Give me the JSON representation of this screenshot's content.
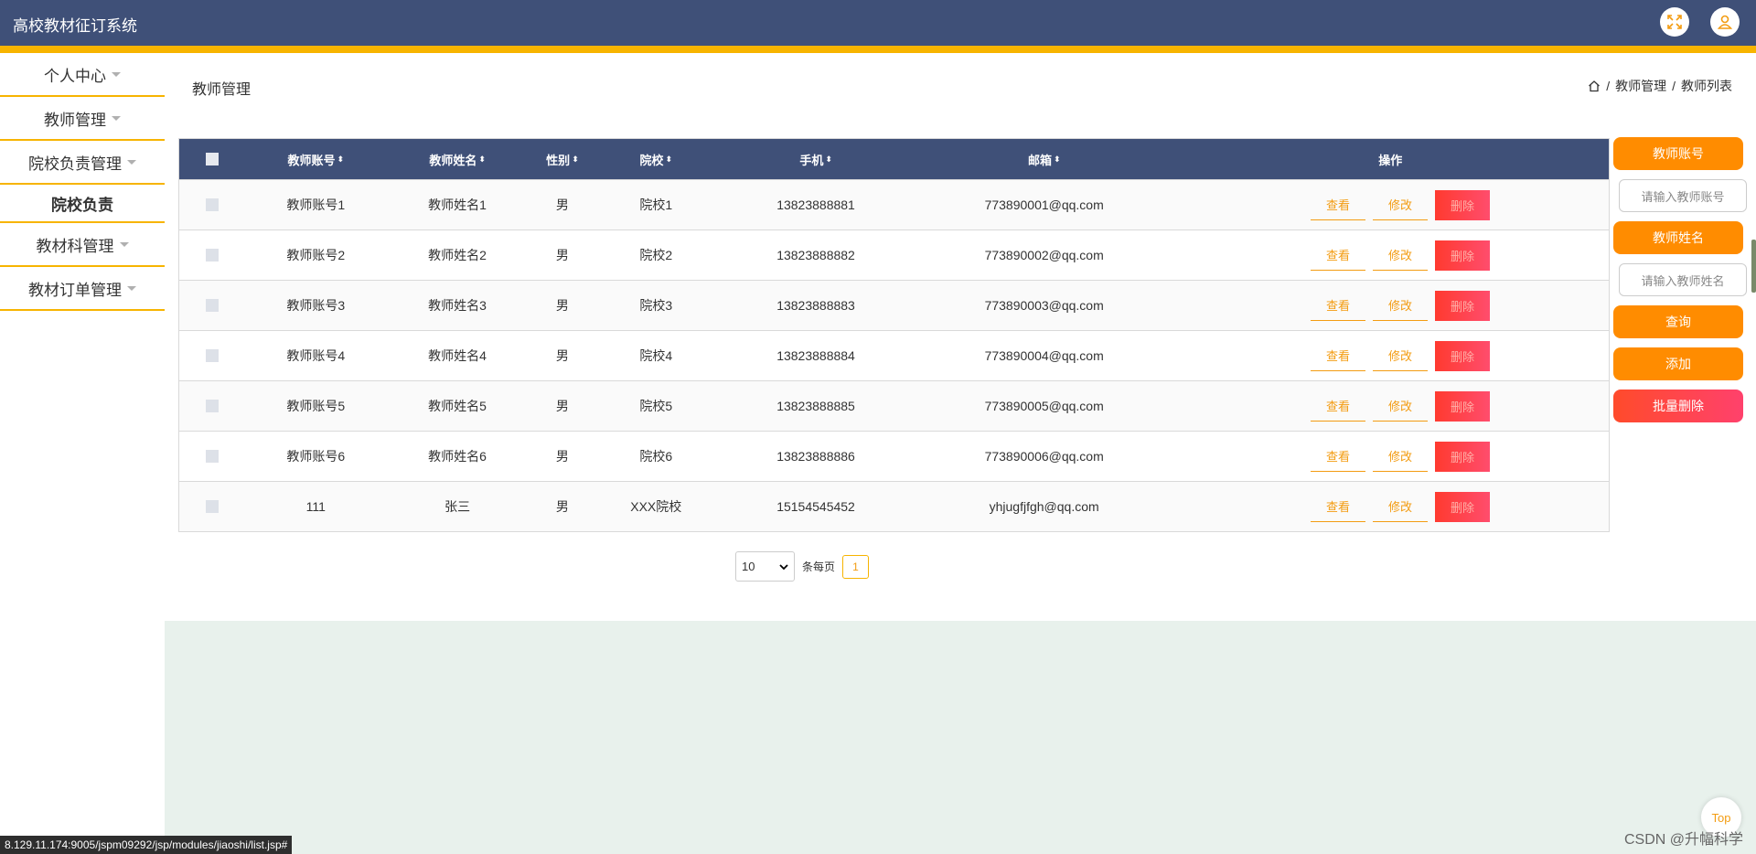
{
  "header": {
    "title": "高校教材征订系统"
  },
  "sidebar": {
    "items": [
      {
        "label": "个人中心"
      },
      {
        "label": "教师管理"
      },
      {
        "label": "院校负责管理"
      },
      {
        "label": "院校负责"
      },
      {
        "label": "教材科管理"
      },
      {
        "label": "教材订单管理"
      }
    ]
  },
  "page": {
    "title": "教师管理",
    "breadcrumb": [
      "教师管理",
      "教师列表"
    ]
  },
  "table": {
    "columns": [
      "教师账号",
      "教师姓名",
      "性别",
      "院校",
      "手机",
      "邮箱",
      "操作"
    ],
    "rows": [
      {
        "account": "教师账号1",
        "name": "教师姓名1",
        "gender": "男",
        "school": "院校1",
        "phone": "13823888881",
        "email": "773890001@qq.com"
      },
      {
        "account": "教师账号2",
        "name": "教师姓名2",
        "gender": "男",
        "school": "院校2",
        "phone": "13823888882",
        "email": "773890002@qq.com"
      },
      {
        "account": "教师账号3",
        "name": "教师姓名3",
        "gender": "男",
        "school": "院校3",
        "phone": "13823888883",
        "email": "773890003@qq.com"
      },
      {
        "account": "教师账号4",
        "name": "教师姓名4",
        "gender": "男",
        "school": "院校4",
        "phone": "13823888884",
        "email": "773890004@qq.com"
      },
      {
        "account": "教师账号5",
        "name": "教师姓名5",
        "gender": "男",
        "school": "院校5",
        "phone": "13823888885",
        "email": "773890005@qq.com"
      },
      {
        "account": "教师账号6",
        "name": "教师姓名6",
        "gender": "男",
        "school": "院校6",
        "phone": "13823888886",
        "email": "773890006@qq.com"
      },
      {
        "account": "111",
        "name": "张三",
        "gender": "男",
        "school": "XXX院校",
        "phone": "15154545452",
        "email": "yhjugfjfgh@qq.com"
      }
    ],
    "actions": {
      "view": "查看",
      "edit": "修改",
      "delete": "删除"
    }
  },
  "pagination": {
    "page_size": "10",
    "per_page_label": "条每页",
    "current_page": "1"
  },
  "search": {
    "account_label": "教师账号",
    "account_placeholder": "请输入教师账号",
    "name_label": "教师姓名",
    "name_placeholder": "请输入教师姓名",
    "query_btn": "查询",
    "add_btn": "添加",
    "batch_delete_btn": "批量删除"
  },
  "footer": {
    "status_url": "8.129.11.174:9005/jspm09292/jsp/modules/jiaoshi/list.jsp#",
    "top_btn": "Top",
    "watermark": "CSDN @升幅科学"
  },
  "colors": {
    "header": "#3f5078",
    "accent": "#f7b400",
    "orange": "#ff8c00",
    "red": "#ff4b2b"
  },
  "icons": [
    "fullscreen-icon",
    "user-icon",
    "home-icon",
    "caret-down-icon",
    "sort-icon",
    "select-chevron-icon"
  ]
}
